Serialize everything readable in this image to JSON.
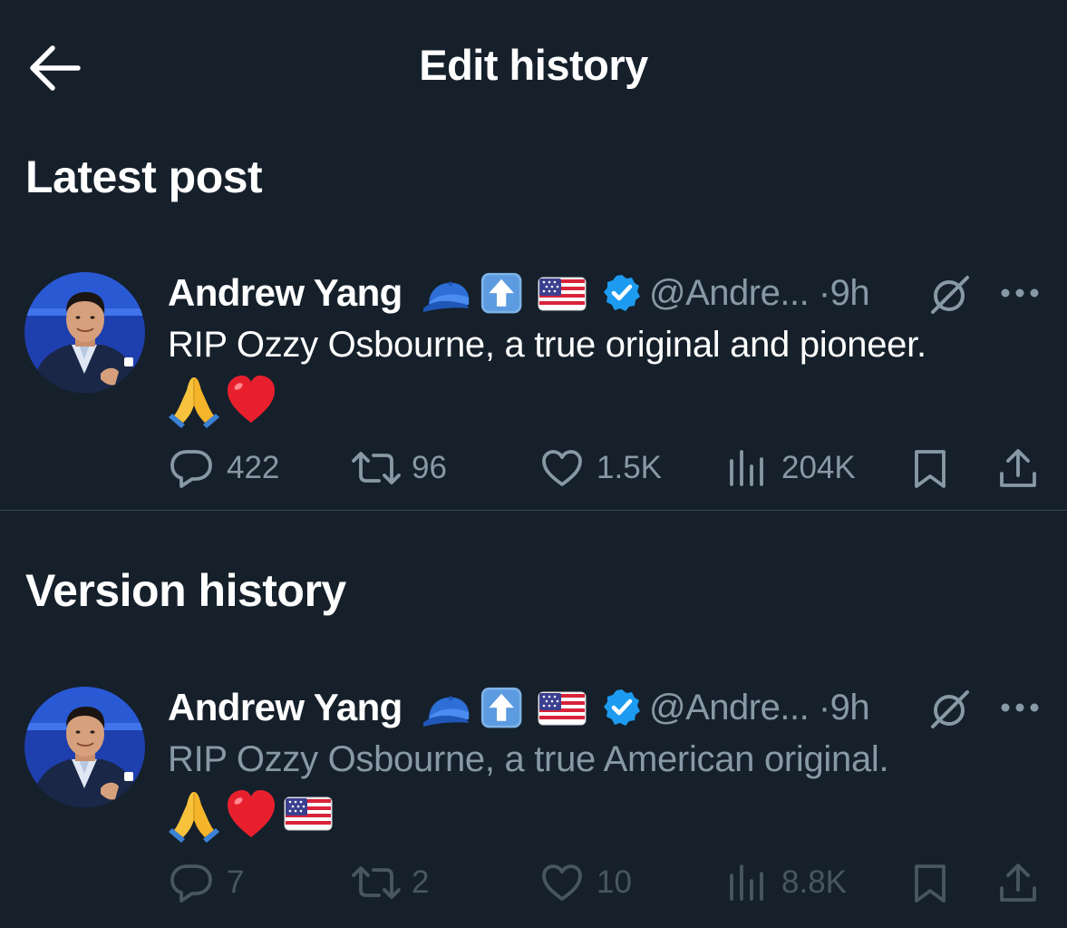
{
  "header": {
    "title": "Edit history"
  },
  "sections": {
    "latest": "Latest post",
    "history": "Version history"
  },
  "colors": {
    "background": "#15202b",
    "text": "#ffffff",
    "secondary": "#8899a6",
    "verified": "#1d9bf0",
    "divider": "#38444d"
  },
  "latest_post": {
    "author": "Andrew Yang",
    "name_emojis": [
      "blue-cap-icon",
      "up-arrow-icon",
      "us-flag-icon"
    ],
    "handle": "@Andre...",
    "dot": "·",
    "time": "9h",
    "text": "RIP Ozzy Osbourne, a true original and pioneer.",
    "emojis": [
      "folded-hands-icon",
      "red-heart-icon"
    ],
    "replies": "422",
    "reposts": "96",
    "likes": "1.5K",
    "views": "204K"
  },
  "old_post": {
    "author": "Andrew Yang",
    "name_emojis": [
      "blue-cap-icon",
      "up-arrow-icon",
      "us-flag-icon"
    ],
    "handle": "@Andre...",
    "dot": "·",
    "time": "9h",
    "text": "RIP Ozzy Osbourne, a true American original.",
    "emojis": [
      "folded-hands-icon",
      "red-heart-icon",
      "us-flag-icon"
    ],
    "replies": "7",
    "reposts": "2",
    "likes": "10",
    "views": "8.8K"
  }
}
